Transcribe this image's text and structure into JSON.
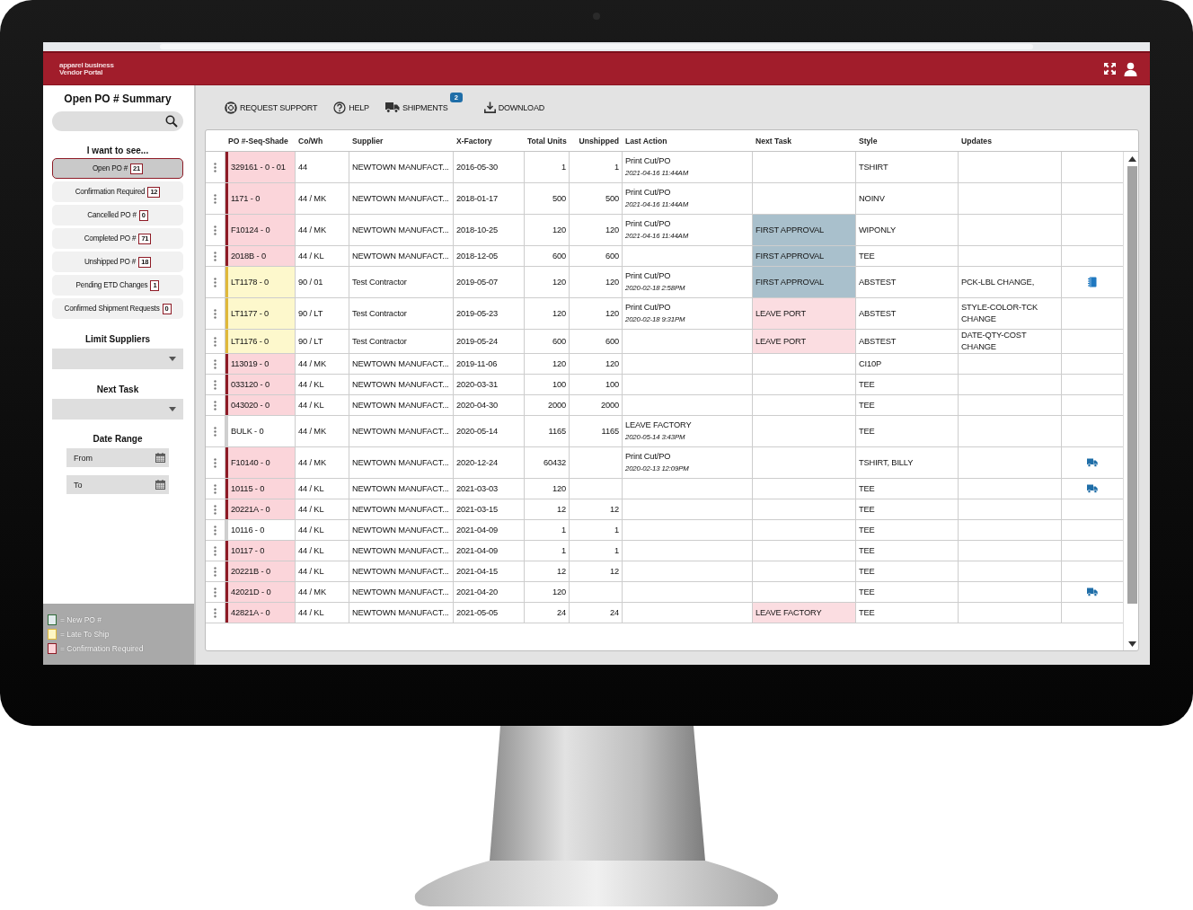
{
  "header": {
    "logo_lines": [
      "apparel business",
      "Vendor  Portal"
    ]
  },
  "sidebar": {
    "title": "Open PO # Summary",
    "filters_title": "I want to see...",
    "filters": [
      {
        "label": "Open PO #",
        "count": "21",
        "selected": true
      },
      {
        "label": "Confirmation Required",
        "count": "12",
        "selected": false
      },
      {
        "label": "Cancelled PO #",
        "count": "0",
        "selected": false
      },
      {
        "label": "Completed PO #",
        "count": "71",
        "selected": false
      },
      {
        "label": "Unshipped PO #",
        "count": "18",
        "selected": false
      },
      {
        "label": "Pending ETD Changes",
        "count": "1",
        "selected": false
      },
      {
        "label": "Confirmed Shipment Requests",
        "count": "0",
        "selected": false
      }
    ],
    "limit_suppliers": {
      "title": "Limit Suppliers"
    },
    "next_task": {
      "title": "Next Task"
    },
    "date_range": {
      "title": "Date Range",
      "from": {
        "placeholder": "From"
      },
      "to": {
        "placeholder": "To"
      }
    },
    "legend": [
      {
        "kind": "new",
        "label": "= New PO #",
        "color": "#e3ecee"
      },
      {
        "kind": "late",
        "label": "= Late To Ship",
        "color": "#fdf6c4"
      },
      {
        "kind": "confirmation",
        "label": "= Confirmation Required",
        "color": "#fbd5da"
      }
    ]
  },
  "toolbar": [
    {
      "kind": "support",
      "label": "REQUEST SUPPORT"
    },
    {
      "kind": "help",
      "label": "HELP"
    },
    {
      "kind": "shipments",
      "label": "SHIPMENTS",
      "badge": "2"
    },
    {
      "kind": "download",
      "label": "DOWNLOAD"
    }
  ],
  "table": {
    "columns": [
      "PO #-Seq-Shade",
      "Co/Wh",
      "Supplier",
      "X-Factory",
      "Total Units",
      "Unshipped",
      "Last Action",
      "Next Task",
      "Style",
      "Updates"
    ],
    "rows": [
      {
        "kind": "confirmation",
        "po": "329161 - 0 - 01",
        "co_wh": "44",
        "supplier": "NEWTOWN MANUFACT...",
        "x_factory": "2016-05-30",
        "total_units": "1",
        "unshipped": "1",
        "last_action": {
          "text": "Print Cut/PO",
          "time": "2021-04-16 11:44AM"
        },
        "style": "TSHIRT"
      },
      {
        "kind": "confirmation",
        "po": "1171 - 0",
        "co_wh": "44 / MK",
        "supplier": "NEWTOWN MANUFACT...",
        "x_factory": "2018-01-17",
        "total_units": "500",
        "unshipped": "500",
        "last_action": {
          "text": "Print Cut/PO",
          "time": "2021-04-16 11:44AM"
        },
        "style": "NOINV"
      },
      {
        "kind": "confirmation",
        "po": "F10124 - 0",
        "co_wh": "44 / MK",
        "supplier": "NEWTOWN MANUFACT...",
        "x_factory": "2018-10-25",
        "total_units": "120",
        "unshipped": "120",
        "last_action": {
          "text": "Print Cut/PO",
          "time": "2021-04-16 11:44AM"
        },
        "next_task": {
          "label": "FIRST APPROVAL",
          "color": "#a9c0cc"
        },
        "style": "WIPONLY"
      },
      {
        "kind": "confirmation",
        "po": "2018B - 0",
        "co_wh": "44 / KL",
        "supplier": "NEWTOWN MANUFACT...",
        "x_factory": "2018-12-05",
        "total_units": "600",
        "unshipped": "600",
        "next_task": {
          "label": "FIRST APPROVAL",
          "color": "#a9c0cc"
        },
        "style": "TEE"
      },
      {
        "kind": "late",
        "po": "LT1178 - 0",
        "co_wh": "90 / 01",
        "supplier": "Test Contractor",
        "x_factory": "2019-05-07",
        "total_units": "120",
        "unshipped": "120",
        "last_action": {
          "text": "Print Cut/PO",
          "time": "2020-02-18 2:58PM"
        },
        "next_task": {
          "label": "FIRST APPROVAL",
          "color": "#a9c0cc"
        },
        "style": "ABSTEST",
        "updates": "PCK-LBL CHANGE,",
        "update_icon": {
          "kind": "notebook"
        }
      },
      {
        "kind": "late",
        "po": "LT1177 - 0",
        "co_wh": "90 / LT",
        "supplier": "Test Contractor",
        "x_factory": "2019-05-23",
        "total_units": "120",
        "unshipped": "120",
        "last_action": {
          "text": "Print Cut/PO",
          "time": "2020-02-18 9:31PM"
        },
        "next_task": {
          "label": "LEAVE PORT",
          "color": "#fbdde1"
        },
        "style": "ABSTEST",
        "updates": "STYLE-COLOR-TCK CHANGE"
      },
      {
        "kind": "late",
        "po": "LT1176 - 0",
        "co_wh": "90 / LT",
        "supplier": "Test Contractor",
        "x_factory": "2019-05-24",
        "total_units": "600",
        "unshipped": "600",
        "next_task": {
          "label": "LEAVE PORT",
          "color": "#fbdde1"
        },
        "style": "ABSTEST",
        "updates": "DATE-QTY-COST CHANGE"
      },
      {
        "kind": "confirmation",
        "po": "113019 - 0",
        "co_wh": "44 / MK",
        "supplier": "NEWTOWN MANUFACT...",
        "x_factory": "2019-11-06",
        "total_units": "120",
        "unshipped": "120",
        "style": "CI10P"
      },
      {
        "kind": "confirmation",
        "po": "033120 - 0",
        "co_wh": "44 / KL",
        "supplier": "NEWTOWN MANUFACT...",
        "x_factory": "2020-03-31",
        "total_units": "100",
        "unshipped": "100",
        "style": "TEE"
      },
      {
        "kind": "confirmation",
        "po": "043020 - 0",
        "co_wh": "44 / KL",
        "supplier": "NEWTOWN MANUFACT...",
        "x_factory": "2020-04-30",
        "total_units": "2000",
        "unshipped": "2000",
        "style": "TEE"
      },
      {
        "kind": "plain",
        "po": "BULK - 0",
        "co_wh": "44 / MK",
        "supplier": "NEWTOWN MANUFACT...",
        "x_factory": "2020-05-14",
        "total_units": "1165",
        "unshipped": "1165",
        "last_action": {
          "text": "LEAVE FACTORY",
          "time": "2020-05-14 3:43PM"
        },
        "style": "TEE"
      },
      {
        "kind": "confirmation",
        "po": "F10140 - 0",
        "co_wh": "44 / MK",
        "supplier": "NEWTOWN MANUFACT...",
        "x_factory": "2020-12-24",
        "total_units": "60432",
        "last_action": {
          "text": "Print Cut/PO",
          "time": "2020-02-13 12:09PM"
        },
        "style": "TSHIRT, BILLY",
        "update_icon": {
          "kind": "truck"
        }
      },
      {
        "kind": "confirmation",
        "po": "10115 - 0",
        "co_wh": "44 / KL",
        "supplier": "NEWTOWN MANUFACT...",
        "x_factory": "2021-03-03",
        "total_units": "120",
        "style": "TEE",
        "update_icon": {
          "kind": "truck"
        }
      },
      {
        "kind": "confirmation",
        "po": "20221A - 0",
        "co_wh": "44 / KL",
        "supplier": "NEWTOWN MANUFACT...",
        "x_factory": "2021-03-15",
        "total_units": "12",
        "unshipped": "12",
        "style": "TEE"
      },
      {
        "kind": "plain",
        "po": "10116 - 0",
        "co_wh": "44 / KL",
        "supplier": "NEWTOWN MANUFACT...",
        "x_factory": "2021-04-09",
        "total_units": "1",
        "unshipped": "1",
        "style": "TEE"
      },
      {
        "kind": "confirmation",
        "po": "10117 - 0",
        "co_wh": "44 / KL",
        "supplier": "NEWTOWN MANUFACT...",
        "x_factory": "2021-04-09",
        "total_units": "1",
        "unshipped": "1",
        "style": "TEE"
      },
      {
        "kind": "confirmation",
        "po": "20221B - 0",
        "co_wh": "44 / KL",
        "supplier": "NEWTOWN MANUFACT...",
        "x_factory": "2021-04-15",
        "total_units": "12",
        "unshipped": "12",
        "style": "TEE"
      },
      {
        "kind": "confirmation",
        "po": "42021D - 0",
        "co_wh": "44 / MK",
        "supplier": "NEWTOWN MANUFACT...",
        "x_factory": "2021-04-20",
        "total_units": "120",
        "style": "TEE",
        "update_icon": {
          "kind": "truck"
        }
      },
      {
        "kind": "confirmation",
        "po": "42821A - 0",
        "co_wh": "44 / KL",
        "supplier": "NEWTOWN MANUFACT...",
        "x_factory": "2021-05-05",
        "total_units": "24",
        "unshipped": "24",
        "next_task": {
          "label": "LEAVE FACTORY",
          "color": "#fbdde1"
        },
        "style": "TEE"
      }
    ]
  }
}
